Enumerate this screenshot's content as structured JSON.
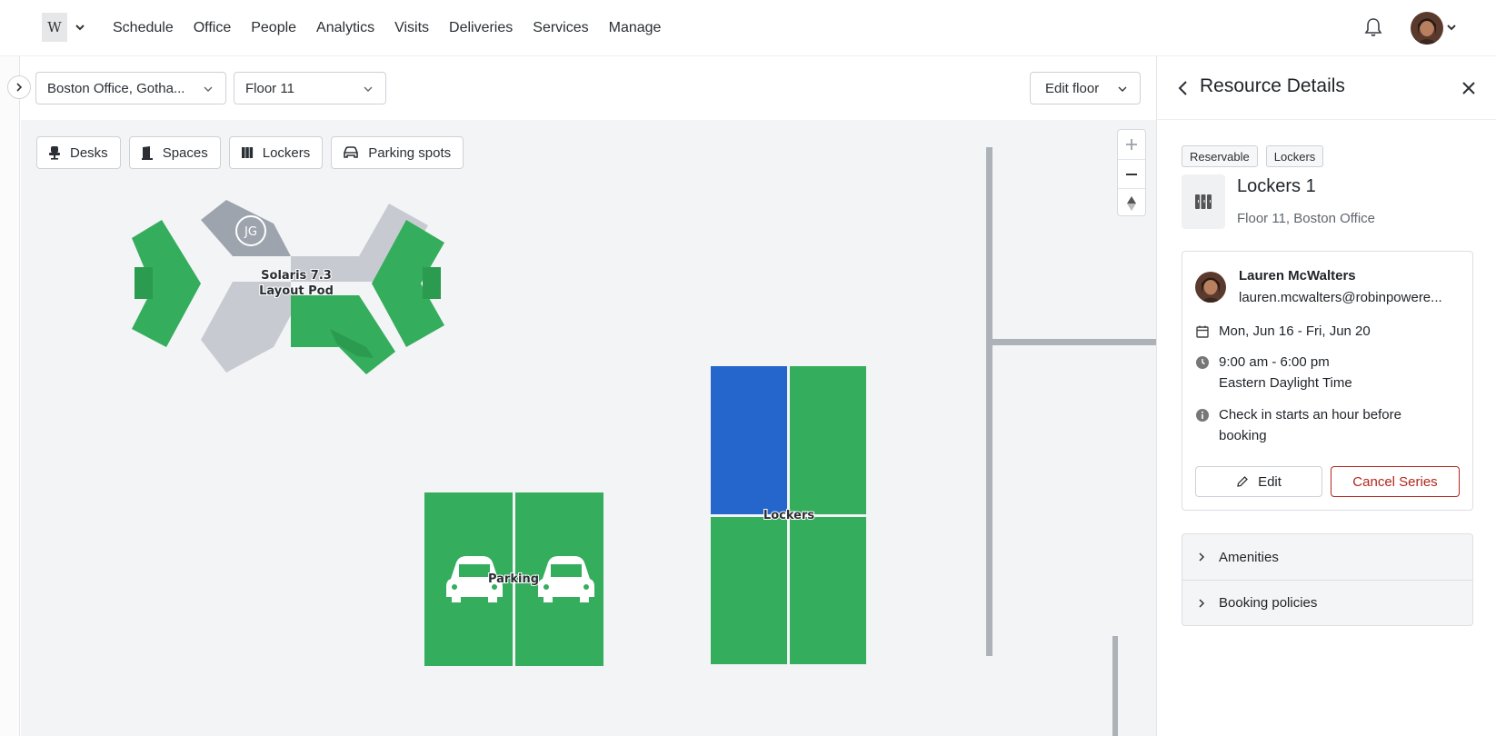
{
  "header": {
    "logo_text": "W",
    "nav": [
      "Schedule",
      "Office",
      "People",
      "Analytics",
      "Visits",
      "Deliveries",
      "Services",
      "Manage"
    ]
  },
  "map_toolbar": {
    "office_select": "Boston Office, Gotha...",
    "floor_select": "Floor 11",
    "edit_floor": "Edit floor"
  },
  "filters": [
    {
      "label": "Desks",
      "icon": "chair-icon"
    },
    {
      "label": "Spaces",
      "icon": "door-icon"
    },
    {
      "label": "Lockers",
      "icon": "locker-icon"
    },
    {
      "label": "Parking spots",
      "icon": "car-icon"
    }
  ],
  "map": {
    "pod_label_line1": "Solaris 7.3",
    "pod_label_line2": "Layout Pod",
    "pod_user_initials": "JG",
    "parking_label": "Parking",
    "lockers_label": "Lockers",
    "colors": {
      "available": "#34ad5c",
      "selected": "#2566cc",
      "occupied": "#9ea4ad",
      "unavailable": "#c7cbd1",
      "wall": "#adb2b8"
    }
  },
  "panel": {
    "title": "Resource Details",
    "tags": [
      "Reservable",
      "Lockers"
    ],
    "resource_name": "Lockers 1",
    "resource_location": "Floor 11, Boston Office",
    "booking": {
      "name": "Lauren McWalters",
      "email": "lauren.mcwalters@robinpowere...",
      "dates": "Mon, Jun 16 - Fri, Jun 20",
      "time": "9:00 am - 6:00 pm",
      "timezone": "Eastern Daylight Time",
      "checkin_line1": "Check in starts an hour before",
      "checkin_line2": "booking",
      "edit": "Edit",
      "cancel": "Cancel Series"
    },
    "sections": [
      "Amenities",
      "Booking policies"
    ]
  }
}
